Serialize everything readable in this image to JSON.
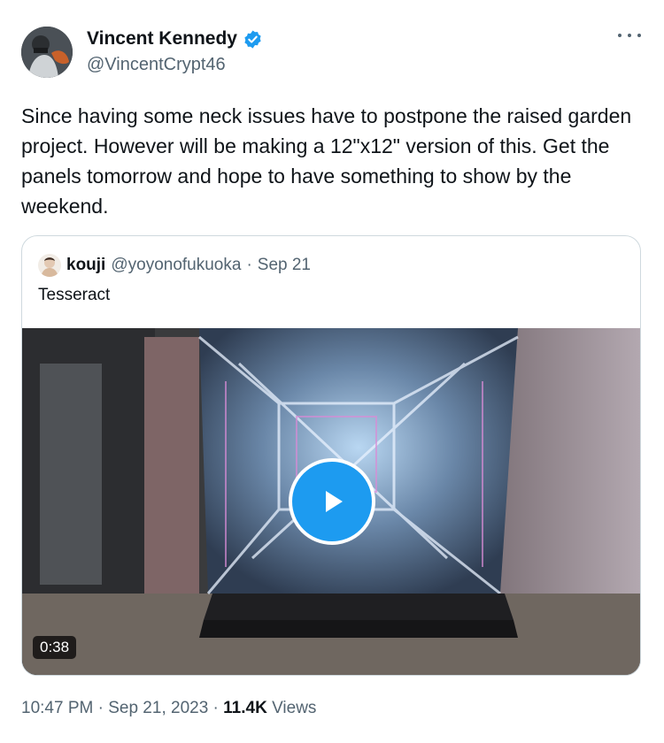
{
  "tweet": {
    "author_name": "Vincent Kennedy",
    "author_handle": "@VincentCrypt46",
    "text": "Since having some neck issues have to postpone the raised garden project. However will be making a 12\"x12\" version of this. Get the panels tomorrow and hope to have something to show by the weekend.",
    "time": "10:47 PM",
    "date": "Sep 21, 2023",
    "views_count": "11.4K",
    "views_label": "Views",
    "separator": "·"
  },
  "quoted": {
    "author_name": "kouji",
    "author_handle": "@yoyonofukuoka",
    "date": "Sep 21",
    "text": "Tesseract",
    "video_duration": "0:38"
  },
  "icons": {
    "verified": "verified-badge-icon",
    "more": "more-options-icon",
    "play": "play-icon"
  },
  "colors": {
    "accent": "#1d9bf0",
    "text": "#0f1419",
    "secondary": "#536471",
    "border": "#cfd9de"
  }
}
